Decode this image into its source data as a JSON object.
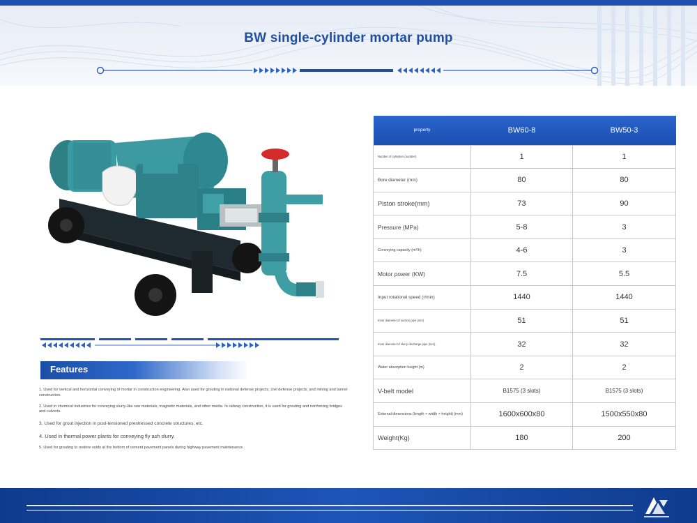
{
  "page": {
    "title": "BW single-cylinder mortar pump"
  },
  "colors": {
    "brand": "#1d4fae",
    "header_table": "#1f55b8",
    "title_text": "#1f4ea0"
  },
  "icons": {
    "title_rule_left": "right-arrows-icon",
    "title_rule_right": "left-arrows-icon",
    "logo": "company-logo-icon"
  },
  "features": {
    "title": "Features",
    "items": [
      "1. Used for vertical and horizontal conveying of mortar in construction engineering. Also used for grouting in national defense projects, civil defense projects, and mining and tunnel construction.",
      "2. Used in chemical industries for conveying slurry-like raw materials, magnetic materials, and other media. In railway construction, it is used for grouting and reinforcing bridges and culverts.",
      "3. Used for grout injection in post-tensioned prestressed concrete structures, etc.",
      "4. Used in thermal power plants for conveying fly ash slurry.",
      "5. Used for grouting to restore voids at the bottom of cement pavement panels during highway pavement maintenance."
    ]
  },
  "table": {
    "header": {
      "property": "property",
      "model_a": "BW60-8",
      "model_b": "BW50-3"
    },
    "rows": [
      {
        "label": "Number of cylinders (number)",
        "a": "1",
        "b": "1"
      },
      {
        "label": "Bore diameter (mm)",
        "a": "80",
        "b": "80"
      },
      {
        "label": "Piston stroke(mm)",
        "a": "73",
        "b": "90"
      },
      {
        "label": "Pressure (MPa)",
        "a": "5-8",
        "b": "3"
      },
      {
        "label": "Conveying capacity (m³/h)",
        "a": "4-6",
        "b": "3"
      },
      {
        "label": "Motor power (KW)",
        "a": "7.5",
        "b": "5.5"
      },
      {
        "label": "Input rotational speed (r/min)",
        "a": "1440",
        "b": "1440"
      },
      {
        "label": "Inner diameter of suction pipe (mm)",
        "a": "51",
        "b": "51"
      },
      {
        "label": "Inner diameter of slurry discharge pipe (mm)",
        "a": "32",
        "b": "32"
      },
      {
        "label": "Water absorption height (m)",
        "a": "2",
        "b": "2"
      },
      {
        "label": "V-belt model",
        "a": "B1575 (3 slots)",
        "b": "B1575 (3 slots)"
      },
      {
        "label": "External dimensions (length × width × height) (mm)",
        "a": "1600x600x80",
        "b": "1500x550x80"
      },
      {
        "label": "Weight(Kg)",
        "a": "180",
        "b": "200"
      }
    ]
  }
}
